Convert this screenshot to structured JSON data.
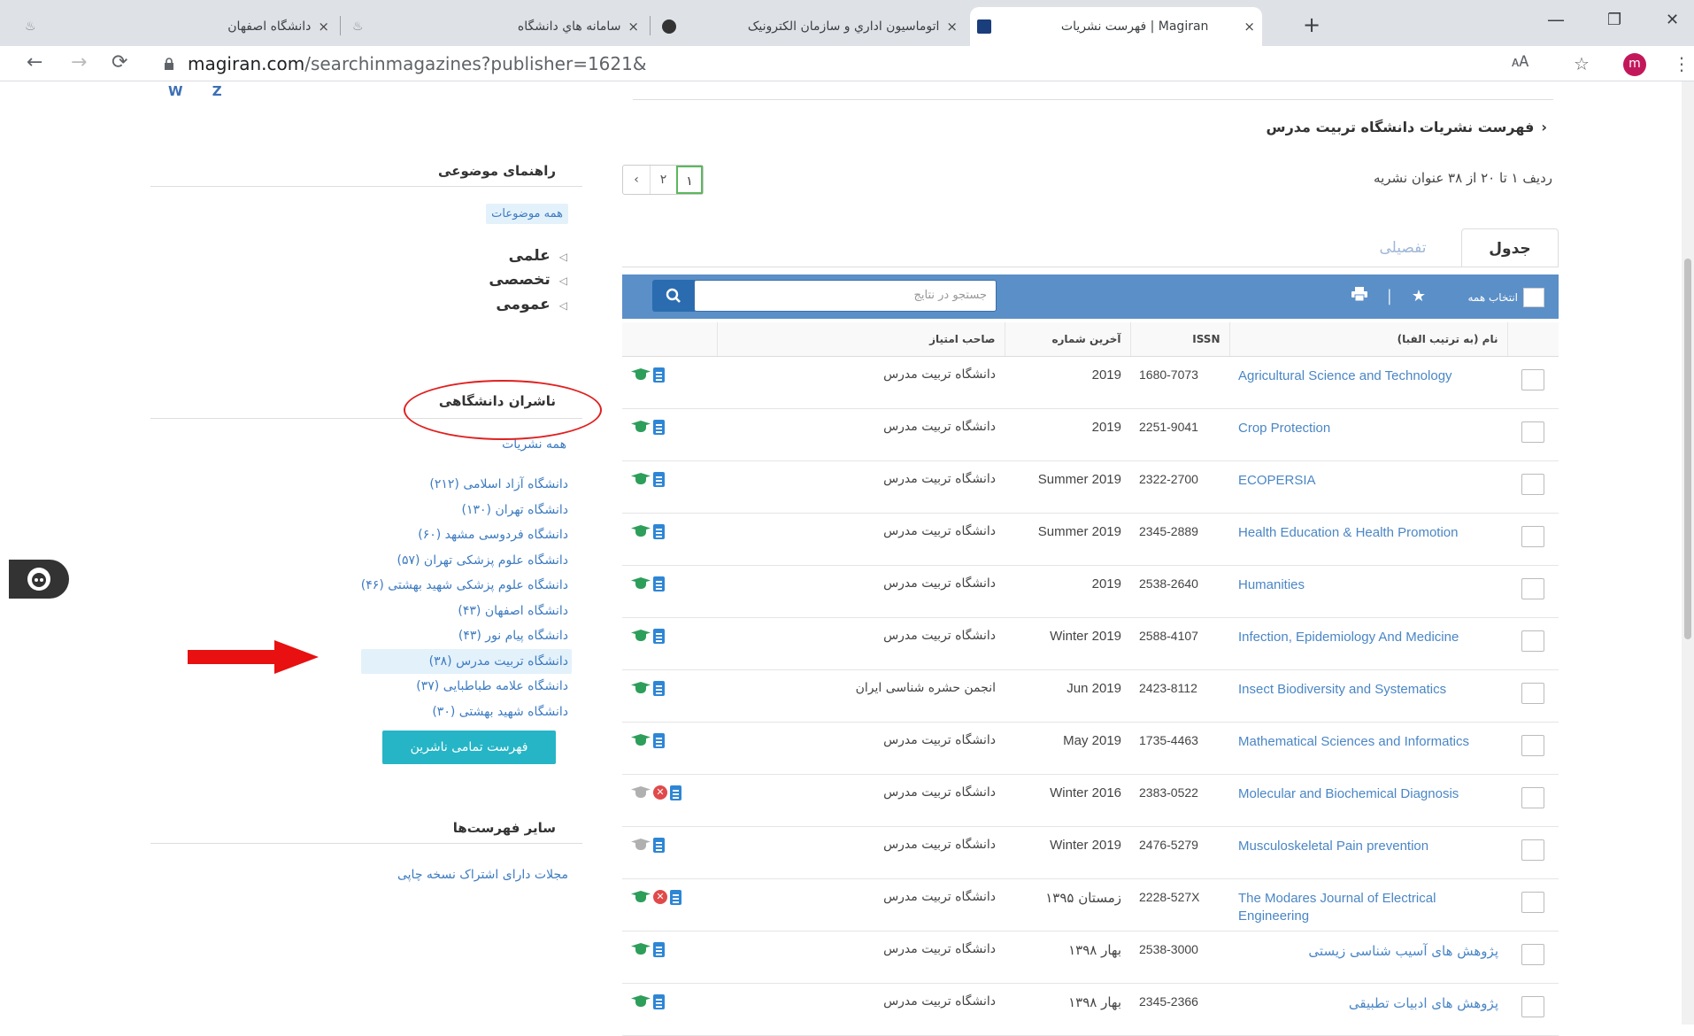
{
  "browser": {
    "tabs": [
      {
        "title": "دانشگاه اصفهان",
        "close": "×"
      },
      {
        "title": "سامانه هاي دانشگاه",
        "close": "×"
      },
      {
        "title": "اتوماسیون اداري و سازمان الکترونیک",
        "close": "×"
      },
      {
        "title": "فهرست نشریات | Magiran",
        "close": "×"
      }
    ],
    "new_tab": "+",
    "url_host": "magiran.com",
    "url_path": "/searchinmagazines?publisher=1621&",
    "avatar_letter": "m",
    "window_controls": [
      "—",
      "❐",
      "✕"
    ]
  },
  "alpha_letters": "W Z",
  "page_title": "فهرست نشریات دانشگاه تربیت مدرس",
  "page_title_chevron": "‹",
  "result_count": "ردیف ۱ تا ۲۰ از ۳۸ عنوان نشریه",
  "pager": [
    "‹",
    "۲",
    "۱"
  ],
  "view_tabs": {
    "active": "جدول",
    "inactive": "تفصیلی"
  },
  "toolbar": {
    "select_all": "انتخاب همه",
    "search_placeholder": "جستجو در نتایج",
    "icons": [
      "star-icon",
      "print-icon",
      "search-icon"
    ]
  },
  "table": {
    "headers": {
      "name": "نام (به ترتیب الفبا)",
      "issn": "ISSN",
      "last": "آخرین شماره",
      "publisher": "صاحب امتیاز"
    },
    "rows": [
      {
        "name": "Agricultural Science and Technology",
        "issn": "1680-7073",
        "last": "2019",
        "publisher": "دانشگاه تربیت مدرس",
        "cap": "green",
        "rejected": false
      },
      {
        "name": "Crop Protection",
        "issn": "2251-9041",
        "last": "2019",
        "publisher": "دانشگاه تربیت مدرس",
        "cap": "green",
        "rejected": false
      },
      {
        "name": "ECOPERSIA",
        "issn": "2322-2700",
        "last": "Summer 2019",
        "publisher": "دانشگاه تربیت مدرس",
        "cap": "green",
        "rejected": false
      },
      {
        "name": "Health Education & Health Promotion",
        "issn": "2345-2889",
        "last": "Summer 2019",
        "publisher": "دانشگاه تربیت مدرس",
        "cap": "green",
        "rejected": false
      },
      {
        "name": "Humanities",
        "issn": "2538-2640",
        "last": "2019",
        "publisher": "دانشگاه تربیت مدرس",
        "cap": "green",
        "rejected": false
      },
      {
        "name": "Infection, Epidemiology And Medicine",
        "issn": "2588-4107",
        "last": "Winter 2019",
        "publisher": "دانشگاه تربیت مدرس",
        "cap": "green",
        "rejected": false
      },
      {
        "name": "Insect Biodiversity and Systematics",
        "issn": "2423-8112",
        "last": "Jun 2019",
        "publisher": "انجمن حشره شناسی ایران",
        "cap": "green",
        "rejected": false
      },
      {
        "name": "Mathematical Sciences and Informatics",
        "issn": "1735-4463",
        "last": "May 2019",
        "publisher": "دانشگاه تربیت مدرس",
        "cap": "green",
        "rejected": false
      },
      {
        "name": "Molecular and Biochemical Diagnosis",
        "issn": "2383-0522",
        "last": "Winter 2016",
        "publisher": "دانشگاه تربیت مدرس",
        "cap": "gray",
        "rejected": true
      },
      {
        "name": "Musculoskeletal Pain prevention",
        "issn": "2476-5279",
        "last": "Winter 2019",
        "publisher": "دانشگاه تربیت مدرس",
        "cap": "gray",
        "rejected": false
      },
      {
        "name": "The Modares Journal of Electrical Engineering",
        "issn": "2228-527X",
        "last": "زمستان ۱۳۹۵",
        "publisher": "دانشگاه تربیت مدرس",
        "cap": "green",
        "rejected": true
      },
      {
        "name": "پژوهش های آسیب شناسی زیستی",
        "issn": "2538-3000",
        "last": "بهار ۱۳۹۸",
        "publisher": "دانشگاه تربیت مدرس",
        "cap": "green",
        "rejected": false
      },
      {
        "name": "پژوهش های ادبیات تطبیقی",
        "issn": "2345-2366",
        "last": "بهار ۱۳۹۸",
        "publisher": "دانشگاه تربیت مدرس",
        "cap": "green",
        "rejected": false
      }
    ]
  },
  "sidebar": {
    "subject_heading": "راهنمای موضوعی",
    "all_subjects": "همه موضوعات",
    "categories": [
      "علمی",
      "تخصصی",
      "عمومی"
    ],
    "publishers_heading": "ناشران دانشگاهی",
    "all_publications": "همه نشریات",
    "publishers": [
      "دانشگاه آزاد اسلامی (۲۱۲)",
      "دانشگاه تهران (۱۳۰)",
      "دانشگاه فردوسی مشهد (۶۰)",
      "دانشگاه علوم پزشکی تهران (۵۷)",
      "دانشگاه علوم پزشکی شهید بهشتی (۴۶)",
      "دانشگاه اصفهان (۴۳)",
      "دانشگاه پیام نور (۴۳)",
      "دانشگاه تربیت مدرس (۳۸)",
      "دانشگاه علامه طباطبایی (۳۷)",
      "دانشگاه شهید بهشتی (۳۰)"
    ],
    "all_publishers_button": "فهرست تمامی ناشرین",
    "other_lists_heading": "سایر فهرست‌ها",
    "other_lists_item": "مجلات دارای اشتراک نسخه چاپی"
  },
  "colors": {
    "accent": "#5b8fc7",
    "link": "#3d7bc0",
    "annotation": "#e02020",
    "button": "#25b5c6"
  }
}
